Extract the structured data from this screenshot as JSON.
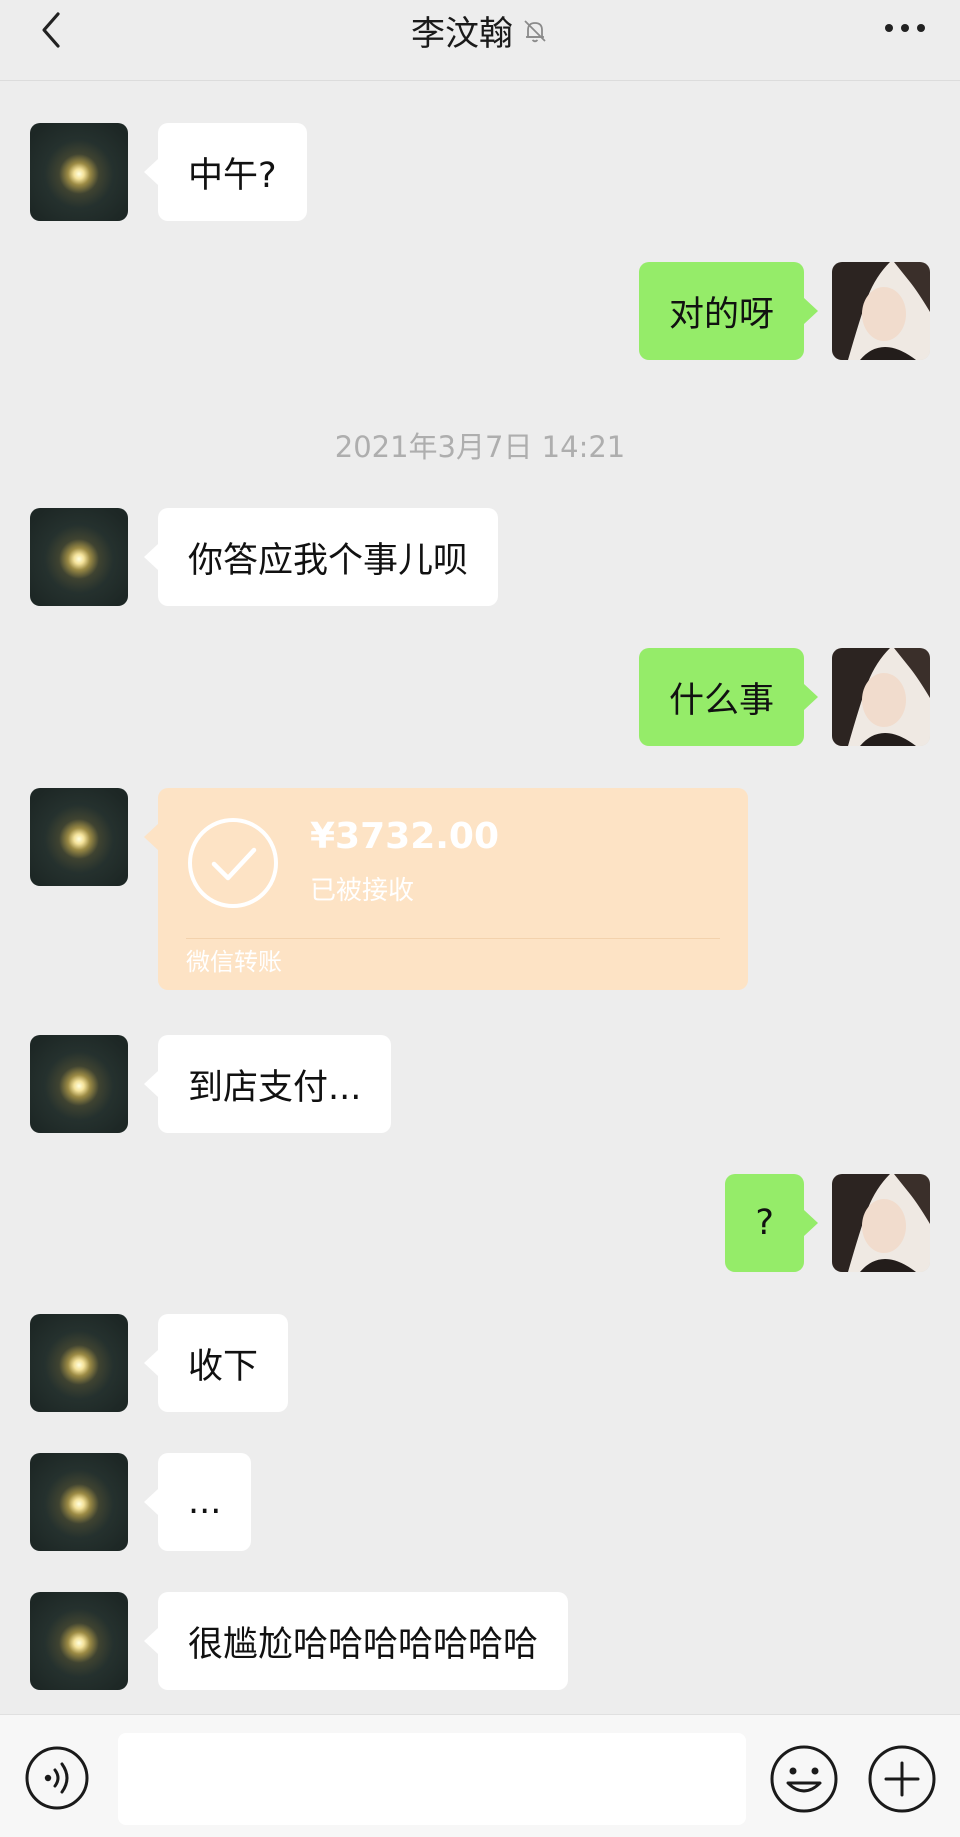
{
  "header": {
    "back_icon": "chevron-left-icon",
    "title": "李汶翰",
    "mute_icon": "bell-off-icon",
    "more_icon": "more-horizontal-icon"
  },
  "timestamp": "2021年3月7日 14:21",
  "messages": [
    {
      "side": "left",
      "text": "中午?"
    },
    {
      "side": "right",
      "text": "对的呀"
    },
    {
      "side": "left",
      "text": "你答应我个事儿呗"
    },
    {
      "side": "right",
      "text": "什么事"
    },
    {
      "side": "left",
      "type": "transfer"
    },
    {
      "side": "left",
      "text": "到店支付..."
    },
    {
      "side": "right",
      "text": "?"
    },
    {
      "side": "left",
      "text": "收下"
    },
    {
      "side": "left",
      "text": "..."
    },
    {
      "side": "left",
      "text": "很尴尬哈哈哈哈哈哈哈"
    }
  ],
  "transfer": {
    "amount": "¥3732.00",
    "status": "已被接收",
    "footer": "微信转账",
    "icon": "check-circle-icon",
    "color": "#fde3c5"
  },
  "input_bar": {
    "voice_icon": "voice-icon",
    "emoji_icon": "smile-icon",
    "plus_icon": "plus-circle-icon"
  },
  "colors": {
    "background": "#ededed",
    "my_bubble": "#95ec69",
    "their_bubble": "#ffffff"
  }
}
